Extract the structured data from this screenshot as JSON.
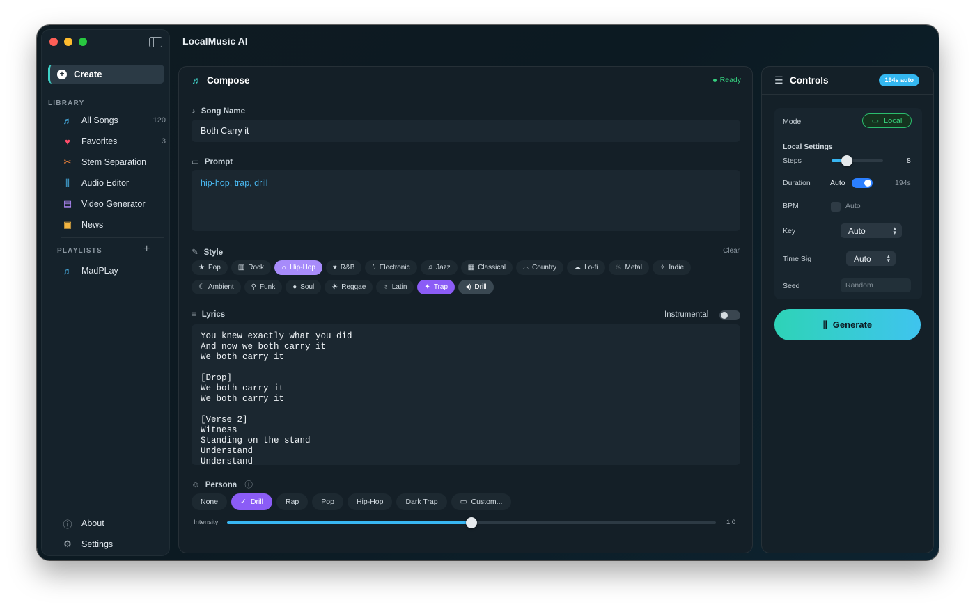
{
  "app": {
    "title": "LocalMusic AI"
  },
  "colors": {
    "accent_teal": "#3fd1c7",
    "accent_purple": "#8b5cf6",
    "accent_blue": "#38b6f2",
    "ready_green": "#35d07f"
  },
  "sidebar": {
    "create_label": "Create",
    "library_label": "LIBRARY",
    "items": [
      {
        "label": "All Songs",
        "count": "120",
        "icon": "music-list-icon"
      },
      {
        "label": "Favorites",
        "count": "3",
        "icon": "heart-icon"
      },
      {
        "label": "Stem Separation",
        "count": "",
        "icon": "scissors-icon"
      },
      {
        "label": "Audio Editor",
        "count": "",
        "icon": "waveform-icon"
      },
      {
        "label": "Video Generator",
        "count": "",
        "icon": "film-icon"
      },
      {
        "label": "News",
        "count": "",
        "icon": "newspaper-icon"
      }
    ],
    "playlists_label": "PLAYLISTS",
    "playlists": [
      {
        "label": "MadPLay"
      }
    ],
    "about_label": "About",
    "settings_label": "Settings"
  },
  "compose": {
    "title": "Compose",
    "status": "Ready",
    "song_name_label": "Song Name",
    "song_name_value": "Both Carry it",
    "prompt_label": "Prompt",
    "prompt_value": "hip-hop, trap, drill",
    "style_label": "Style",
    "clear_label": "Clear",
    "styles_row1": [
      {
        "label": "Pop",
        "icon": "★",
        "selected": ""
      },
      {
        "label": "Rock",
        "icon": "▥",
        "selected": ""
      },
      {
        "label": "Hip-Hop",
        "icon": "∩",
        "selected": "lilac"
      },
      {
        "label": "R&B",
        "icon": "♥",
        "selected": ""
      },
      {
        "label": "Electronic",
        "icon": "ϟ",
        "selected": ""
      },
      {
        "label": "Jazz",
        "icon": "♫",
        "selected": ""
      },
      {
        "label": "Classical",
        "icon": "▦",
        "selected": ""
      },
      {
        "label": "Country",
        "icon": "⌓",
        "selected": ""
      },
      {
        "label": "Lo-fi",
        "icon": "☁",
        "selected": ""
      },
      {
        "label": "Metal",
        "icon": "♨",
        "selected": ""
      },
      {
        "label": "Indie",
        "icon": "✧",
        "selected": ""
      }
    ],
    "styles_row2": [
      {
        "label": "Ambient",
        "icon": "☾",
        "selected": ""
      },
      {
        "label": "Funk",
        "icon": "⚲",
        "selected": ""
      },
      {
        "label": "Soul",
        "icon": "●",
        "selected": ""
      },
      {
        "label": "Reggae",
        "icon": "☀",
        "selected": ""
      },
      {
        "label": "Latin",
        "icon": "♁",
        "selected": ""
      },
      {
        "label": "Trap",
        "icon": "✦",
        "selected": "purple"
      },
      {
        "label": "Drill",
        "icon": "◂)",
        "selected": "grey"
      }
    ],
    "lyrics_label": "Lyrics",
    "instrumental_label": "Instrumental",
    "instrumental_on": false,
    "lyrics_text": "You knew exactly what you did\nAnd now we both carry it\nWe both carry it\n\n[Drop]\nWe both carry it\nWe both carry it\n\n[Verse 2]\nWitness\nStanding on the stand\nUnderstand\nUnderstand",
    "persona_label": "Persona",
    "personas": [
      {
        "label": "None",
        "selected": false,
        "icon": ""
      },
      {
        "label": "Drill",
        "selected": true,
        "icon": "✓"
      },
      {
        "label": "Rap",
        "selected": false,
        "icon": ""
      },
      {
        "label": "Pop",
        "selected": false,
        "icon": ""
      },
      {
        "label": "Hip-Hop",
        "selected": false,
        "icon": ""
      },
      {
        "label": "Dark Trap",
        "selected": false,
        "icon": ""
      },
      {
        "label": "Custom...",
        "selected": false,
        "icon": "▭"
      }
    ],
    "intensity_label": "Intensity",
    "intensity_value": "1.0",
    "intensity_fraction": 0.5
  },
  "controls": {
    "title": "Controls",
    "badge": "194s auto",
    "mode_label": "Mode",
    "mode_value": "Local",
    "local_settings_label": "Local Settings",
    "steps_label": "Steps",
    "steps_value": "8",
    "steps_fraction": 0.3,
    "duration_label": "Duration",
    "duration_auto_label": "Auto",
    "duration_value": "194s",
    "bpm_label": "BPM",
    "bpm_auto_label": "Auto",
    "key_label": "Key",
    "key_value": "Auto",
    "timesig_label": "Time Sig",
    "timesig_value": "Auto",
    "seed_label": "Seed",
    "seed_placeholder": "Random",
    "generate_label": "Generate"
  }
}
